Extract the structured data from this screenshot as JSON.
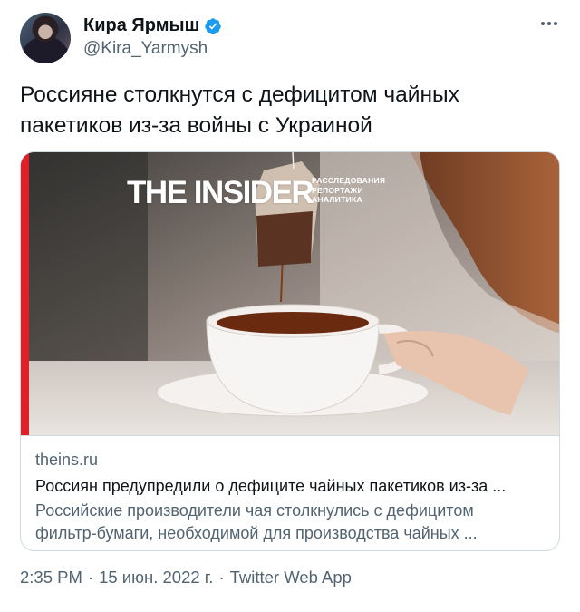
{
  "author": {
    "display_name": "Кира Ярмыш",
    "handle": "@Kira_Yarmysh"
  },
  "tweet": {
    "text_line1": "Россияне столкнутся с дефицитом чайных",
    "text_line2": "пакетиков из-за войны с Украиной"
  },
  "card": {
    "logo": "THE INSIDER",
    "logo_tagline": [
      "РАССЛЕДОВАНИЯ",
      "РЕПОРТАЖИ",
      "АНАЛИТИКА"
    ],
    "domain": "theins.ru",
    "title": "Россиян предупредили о дефиците чайных пакетиков из-за ...",
    "description_line1": "Российские производители чая столкнулись с дефицитом",
    "description_line2": "фильтр-бумаги, необходимой для производства чайных ..."
  },
  "meta": {
    "time": "2:35 PM",
    "separator": "·",
    "date": "15 июн. 2022 г.",
    "source": "Twitter Web App"
  },
  "colors": {
    "verified": "#1d9bf0",
    "secondary_text": "#536471",
    "brand_red": "#e01f26"
  }
}
